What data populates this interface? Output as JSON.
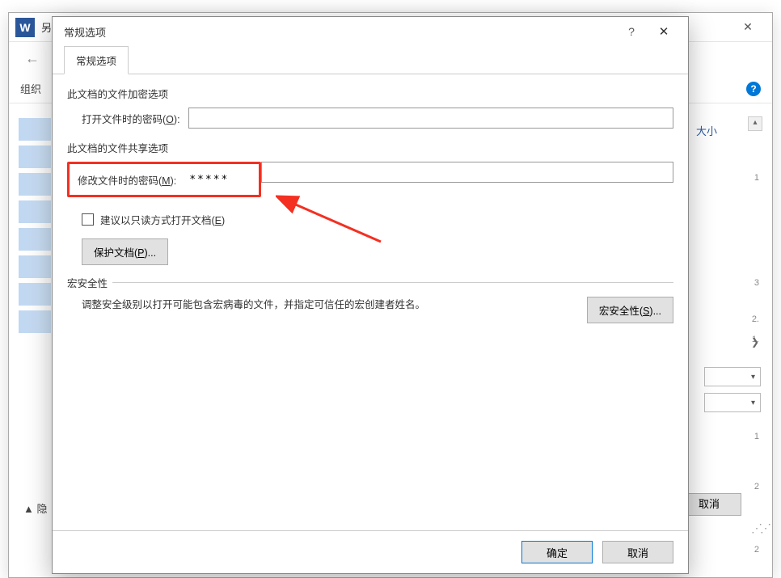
{
  "bg": {
    "word_icon": "W",
    "title_partial": "另",
    "back": "←",
    "toolbar_label": "组织",
    "right_header": "大小",
    "marks": [
      "1",
      "3",
      "2.",
      "1.",
      "1",
      "2",
      "2"
    ],
    "hide_label": "▲ 隐",
    "cancel_btn": "取消"
  },
  "dialog": {
    "title": "常规选项",
    "help": "?",
    "close": "✕",
    "tab_label": "常规选项",
    "encrypt_section": "此文档的文件加密选项",
    "open_pw_label": "打开文件时的密码(O):",
    "open_pw_value": "",
    "share_section": "此文档的文件共享选项",
    "modify_pw_label": "修改文件时的密码(M):",
    "modify_pw_value": "*****",
    "readonly_label": "建议以只读方式打开文档(E)",
    "protect_btn": "保护文档(P)...",
    "macro_title": "宏安全性",
    "macro_text": "调整安全级别以打开可能包含宏病毒的文件，并指定可信任的宏创建者姓名。",
    "macro_btn": "宏安全性(S)...",
    "ok_btn": "确定",
    "cancel_btn": "取消"
  }
}
